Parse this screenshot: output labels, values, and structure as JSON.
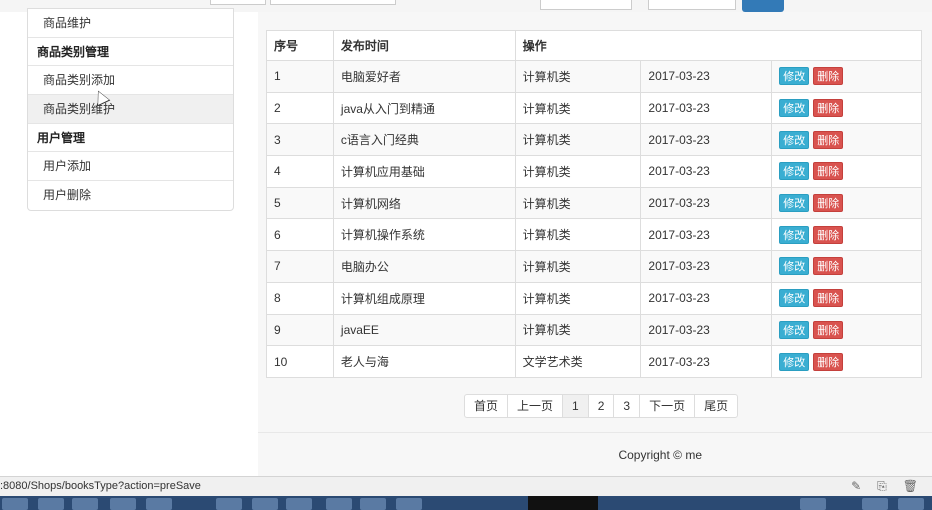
{
  "sidebar": {
    "items": [
      {
        "type": "item",
        "label": "商品维护"
      },
      {
        "type": "head",
        "label": "商品类别管理"
      },
      {
        "type": "item",
        "label": "商品类别添加"
      },
      {
        "type": "item",
        "label": "商品类别维护"
      },
      {
        "type": "head",
        "label": "用户管理"
      },
      {
        "type": "item",
        "label": "用户添加"
      },
      {
        "type": "item",
        "label": "用户删除"
      }
    ]
  },
  "table": {
    "headers": [
      "序号",
      "发布时间",
      "操作"
    ],
    "edit_label": "修改",
    "delete_label": "删除",
    "rows": [
      [
        "1",
        "电脑爱好者",
        "计算机类",
        "2017-03-23"
      ],
      [
        "2",
        "java从入门到精通",
        "计算机类",
        "2017-03-23"
      ],
      [
        "3",
        "c语言入门经典",
        "计算机类",
        "2017-03-23"
      ],
      [
        "4",
        "计算机应用基础",
        "计算机类",
        "2017-03-23"
      ],
      [
        "5",
        "计算机网络",
        "计算机类",
        "2017-03-23"
      ],
      [
        "6",
        "计算机操作系统",
        "计算机类",
        "2017-03-23"
      ],
      [
        "7",
        "电脑办公",
        "计算机类",
        "2017-03-23"
      ],
      [
        "8",
        "计算机组成原理",
        "计算机类",
        "2017-03-23"
      ],
      [
        "9",
        "javaEE",
        "计算机类",
        "2017-03-23"
      ],
      [
        "10",
        "老人与海",
        "文学艺术类",
        "2017-03-23"
      ]
    ]
  },
  "pagination": {
    "items": [
      "首页",
      "上一页",
      "1",
      "2",
      "3",
      "下一页",
      "尾页"
    ],
    "active": "1"
  },
  "footer": {
    "copyright": "Copyright © me"
  },
  "statusbar": {
    "url": ":8080/Shops/booksType?action=preSave"
  },
  "colors": {
    "edit": "#3aaed2",
    "delete": "#d9534f",
    "primary": "#337ab7"
  }
}
